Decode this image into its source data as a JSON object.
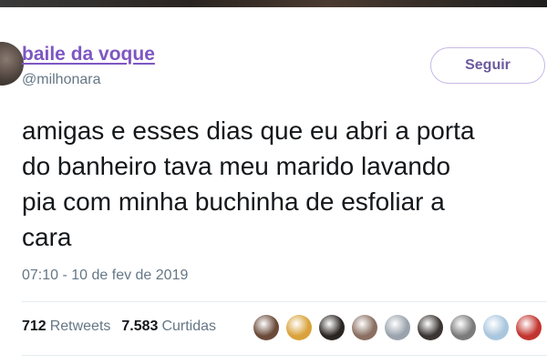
{
  "tweet": {
    "display_name": "baile da voque",
    "handle": "@milhonara",
    "follow_label": "Seguir",
    "text_lines": [
      "amigas e esses dias que eu abri a porta",
      "do banheiro tava meu marido lavando",
      "pia com minha buchinha de esfoliar a",
      "cara"
    ],
    "timestamp": "07:10 - 10 de fev de 2019"
  },
  "stats": {
    "retweets_count": "712",
    "retweets_label": "Retweets",
    "likes_count": "7.583",
    "likes_label": "Curtidas"
  },
  "likers": [
    {
      "color": "#6b4a3a"
    },
    {
      "color": "#d9a23a"
    },
    {
      "color": "#2b2522"
    },
    {
      "color": "#8a6f62"
    },
    {
      "color": "#9aa3ad"
    },
    {
      "color": "#3a3532"
    },
    {
      "color": "#7b7b7b"
    },
    {
      "color": "#a9c6dd"
    },
    {
      "color": "#c2352f"
    }
  ],
  "colors": {
    "name": "#7e57c2",
    "muted": "#657786",
    "text": "#14171a"
  }
}
